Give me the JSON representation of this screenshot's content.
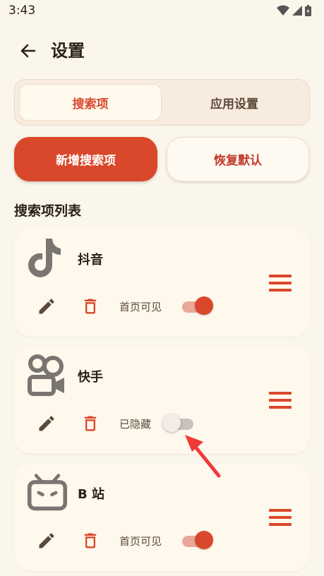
{
  "status_bar": {
    "time": "3:43"
  },
  "header": {
    "title": "设置"
  },
  "tabs": [
    {
      "label": "搜索项",
      "active": true
    },
    {
      "label": "应用设置",
      "active": false
    }
  ],
  "actions": {
    "add_label": "新增搜索项",
    "reset_label": "恢复默认"
  },
  "section": {
    "title": "搜索项列表"
  },
  "items": [
    {
      "name": "抖音",
      "status_label": "首页可见",
      "visible": true,
      "logo": "douyin-logo"
    },
    {
      "name": "快手",
      "status_label": "已隐藏",
      "visible": false,
      "logo": "kuaishou-logo"
    },
    {
      "name": "B 站",
      "status_label": "首页可见",
      "visible": true,
      "logo": "bilibili-logo"
    }
  ],
  "colors": {
    "accent": "#d9482b",
    "background": "#fbf6ec",
    "card": "#fff8ec",
    "annotation": "#f03a3a"
  }
}
